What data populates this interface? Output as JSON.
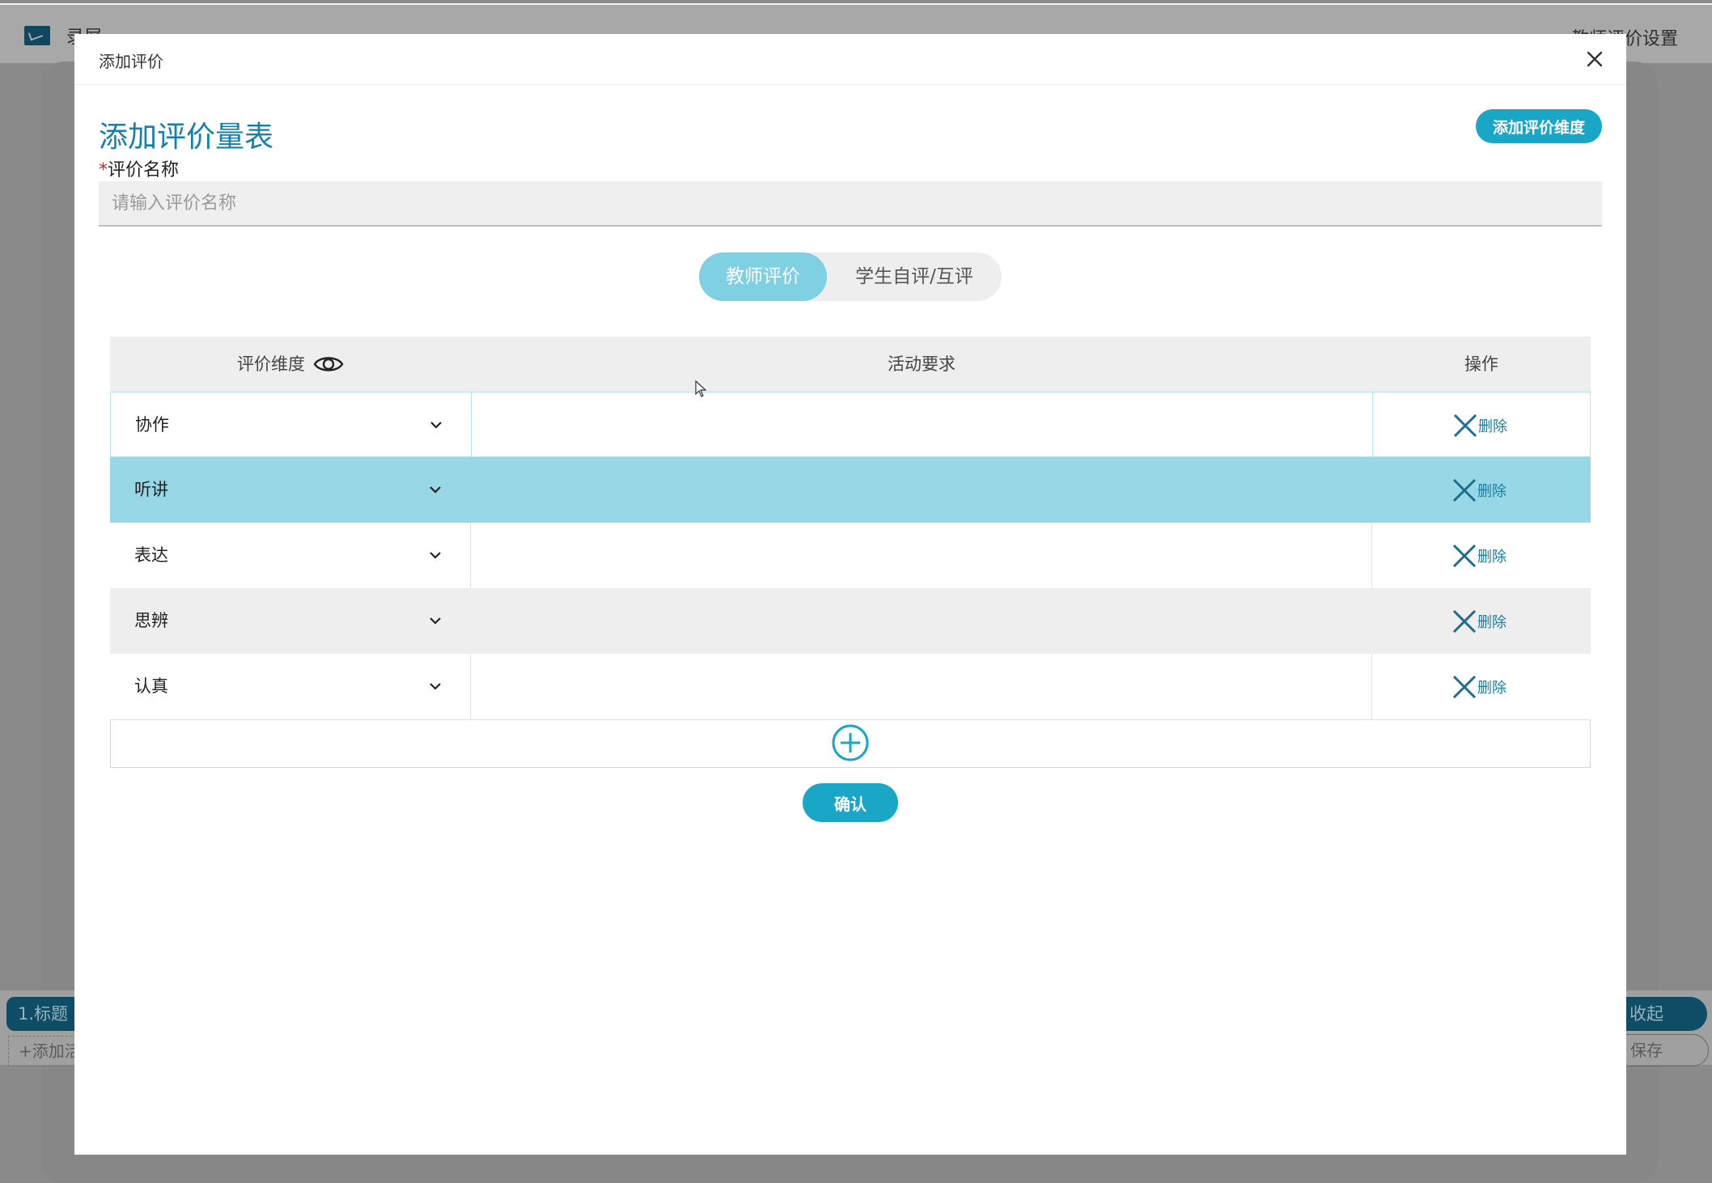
{
  "background": {
    "app_title": "录屏",
    "right_link": "教师评价设置",
    "left_chip": "1.标题",
    "left_add": "+添加活",
    "collapse_label": "收起",
    "save_label": "保存"
  },
  "modal": {
    "header_title": "添加评价",
    "close_icon": "close-icon",
    "page_title": "添加评价量表",
    "add_dimension_label": "添加评价维度",
    "name_field": {
      "required_mark": "*",
      "label": "评价名称",
      "value": "",
      "placeholder": "请输入评价名称"
    },
    "tabs": [
      {
        "label": "教师评价",
        "active": true
      },
      {
        "label": "学生自评/互评",
        "active": false
      }
    ],
    "table": {
      "headers": {
        "dimension": "评价维度",
        "requirement": "活动要求",
        "operation": "操作"
      },
      "rows": [
        {
          "dimension": "协作",
          "requirement": "",
          "delete_label": "删除"
        },
        {
          "dimension": "听讲",
          "requirement": "",
          "delete_label": "删除"
        },
        {
          "dimension": "表达",
          "requirement": "",
          "delete_label": "删除"
        },
        {
          "dimension": "思辨",
          "requirement": "",
          "delete_label": "删除"
        },
        {
          "dimension": "认真",
          "requirement": "",
          "delete_label": "删除"
        }
      ]
    },
    "confirm_label": "确认"
  },
  "colors": {
    "accent": "#1aa6c6",
    "title_blue": "#1680a6",
    "active_tab": "#7fd0e2",
    "highlight_row": "#98d7e5",
    "required": "#e02020"
  }
}
